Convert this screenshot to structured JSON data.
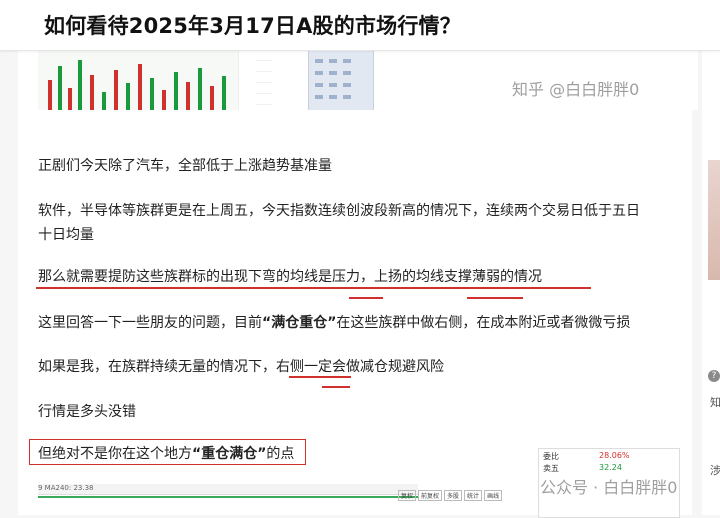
{
  "header": {
    "title": "如何看待2025年3月17日A股的市场行情？"
  },
  "watermarks": {
    "top": "知乎 @白白胖胖0",
    "bottom": "公众号 · 白白胖胖0"
  },
  "paragraphs": {
    "p1": "正剧们今天除了汽车，全部低于上涨趋势基准量",
    "p2a": "软件，半导体等族群更是在上周五，今天指数连续创波段新高的情况下，连续两个交易日低于五日",
    "p2b": "十日均量",
    "p3": "那么就需要提防这些族群标的出现下弯的均线是压力，上扬的均线支撑薄弱的情况",
    "p4_pre": "这里回答一下一些朋友的问题，目前",
    "p4_bold": "“满仓重仓”",
    "p4_post": "在这些族群中做右侧，在成本附近或者微微亏损",
    "p5": "如果是我，在族群持续无量的情况下，右侧一定会做减仓规避风险",
    "p6": "行情是多头没错",
    "p7_pre": "但绝对不是你在这个地方",
    "p7_bold": "“重仓满仓”",
    "p7_post": "的点"
  },
  "bottom_shot": {
    "toolbar_text": "9 MA240: 23.38",
    "buttons": [
      "复权",
      "前复权",
      "多股",
      "统计",
      "画线",
      "F10",
      "标记"
    ],
    "quote": {
      "label1": "委比",
      "value1": "28.06%",
      "label2": "卖五",
      "value2": "32.24"
    }
  },
  "sidebar": {
    "icon1": "?",
    "label1": "知",
    "label2": "涉"
  }
}
